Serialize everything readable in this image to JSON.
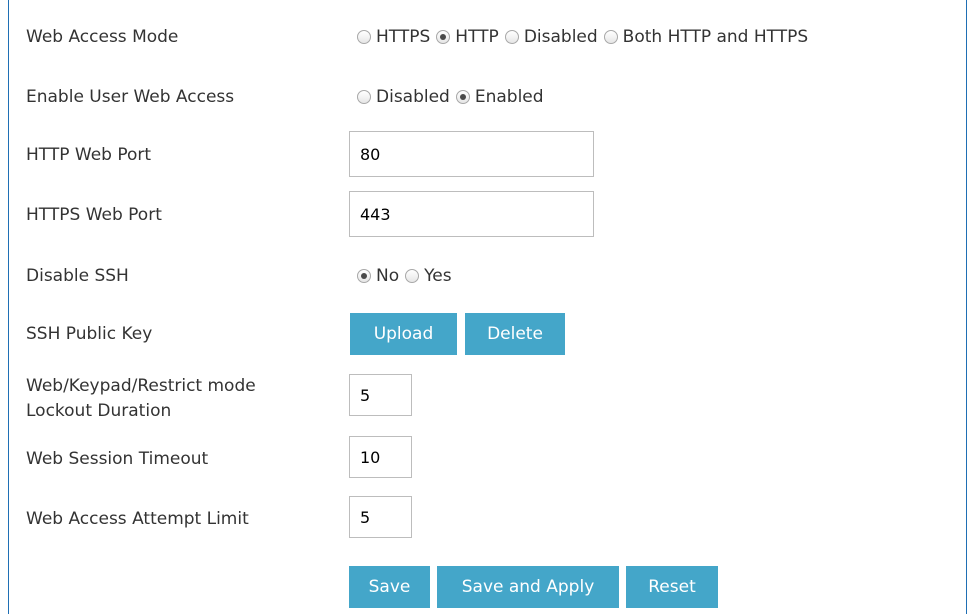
{
  "settings": {
    "web_access_mode": {
      "label": "Web Access Mode",
      "options": [
        "HTTPS",
        "HTTP",
        "Disabled",
        "Both HTTP and HTTPS"
      ],
      "selected": "HTTP"
    },
    "enable_user_web_access": {
      "label": "Enable User Web Access",
      "options": [
        "Disabled",
        "Enabled"
      ],
      "selected": "Enabled"
    },
    "http_web_port": {
      "label": "HTTP Web Port",
      "value": "80"
    },
    "https_web_port": {
      "label": "HTTPS Web Port",
      "value": "443"
    },
    "disable_ssh": {
      "label": "Disable SSH",
      "options": [
        "No",
        "Yes"
      ],
      "selected": "No"
    },
    "ssh_public_key": {
      "label": "SSH Public Key",
      "upload_label": "Upload",
      "delete_label": "Delete"
    },
    "lockout_duration": {
      "label_line1": "Web/Keypad/Restrict mode",
      "label_line2": "Lockout Duration",
      "value": "5"
    },
    "web_session_timeout": {
      "label": "Web Session Timeout",
      "value": "10"
    },
    "web_access_attempt_limit": {
      "label": "Web Access Attempt Limit",
      "value": "5"
    }
  },
  "actions": {
    "save_label": "Save",
    "save_apply_label": "Save and Apply",
    "reset_label": "Reset"
  },
  "colors": {
    "button_bg": "#44a6c9",
    "frame_border": "#1f6fb4",
    "text": "#333333"
  }
}
